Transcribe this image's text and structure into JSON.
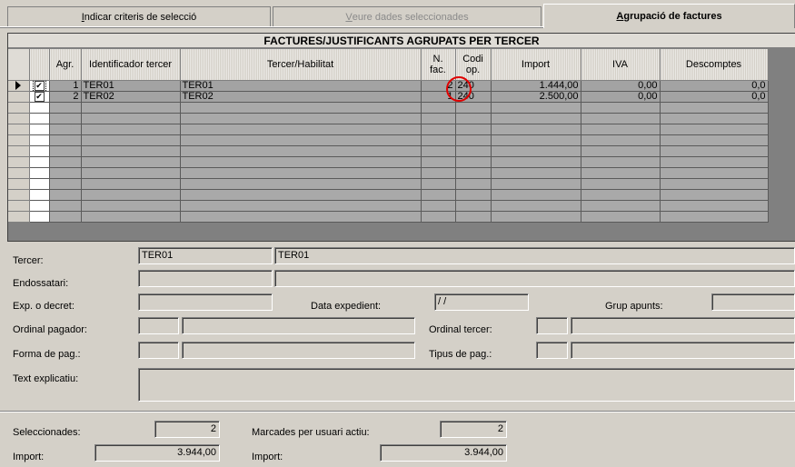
{
  "tabs": [
    {
      "label": "Indicar criteris de selecció",
      "underline": "I",
      "rest": "ndicar criteris de selecció"
    },
    {
      "label": "Veure dades seleccionades",
      "underline": "V",
      "rest": "eure dades seleccionades"
    },
    {
      "label": "Agrupació de factures",
      "underline": "A",
      "rest": "grupació de factures"
    }
  ],
  "grid": {
    "title": "FACTURES/JUSTIFICANTS AGRUPATS PER TERCER",
    "columns": [
      "",
      "",
      "Agr.",
      "Identificador tercer",
      "Tercer/Habilitat",
      "N. fac.",
      "Codi op.",
      "Import",
      "IVA",
      "Descomptes"
    ],
    "rows": [
      {
        "checked": "✔",
        "agr": "1",
        "id": "TER01",
        "tercer": "TER01",
        "nfac": "2",
        "codi": "240",
        "import": "1.444,00",
        "iva": "0,00",
        "desc": "0,0"
      },
      {
        "checked": "✔",
        "agr": "2",
        "id": "TER02",
        "tercer": "TER02",
        "nfac": "1",
        "codi": "240",
        "import": "2.500,00",
        "iva": "0,00",
        "desc": "0,0"
      }
    ]
  },
  "form": {
    "tercer_label": "Tercer:",
    "tercer_code": "TER01",
    "tercer_name": "TER01",
    "endossatari_label": "Endossatari:",
    "exp_label": "Exp. o decret:",
    "data_exp_label": "Data expedient:",
    "data_exp_value": " / /",
    "grup_label": "Grup apunts:",
    "ordinal_pag_label": "Ordinal pagador:",
    "ordinal_ter_label": "Ordinal tercer:",
    "forma_label": "Forma de pag.:",
    "tipus_label": "Tipus de pag.:",
    "text_label": "Text explicatiu:"
  },
  "summary": {
    "sel_label": "Seleccionades:",
    "sel_value": "2",
    "marc_label": "Marcades per usuari actiu:",
    "marc_value": "2",
    "import_label": "Import:",
    "import_value": "3.944,00",
    "import2_label": "Import:",
    "import2_value": "3.944,00"
  }
}
